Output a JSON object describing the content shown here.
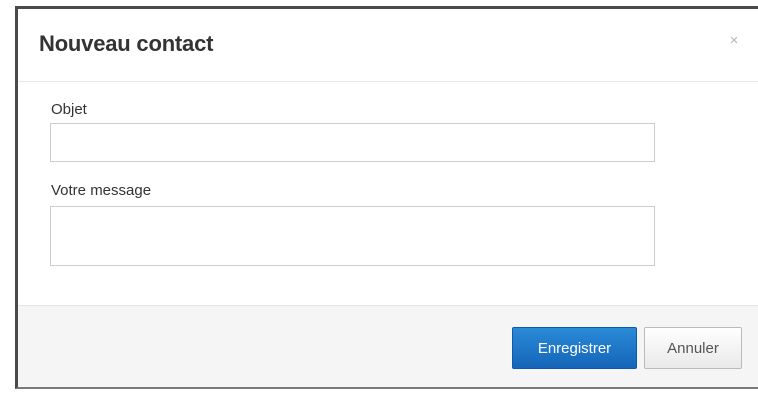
{
  "dialog": {
    "title": "Nouveau contact",
    "close_symbol": "×"
  },
  "form": {
    "subject_label": "Objet",
    "subject_value": "",
    "message_label": "Votre message",
    "message_value": ""
  },
  "footer": {
    "save_label": "Enregistrer",
    "cancel_label": "Annuler"
  },
  "colors": {
    "primary_button": "#1a74c7",
    "footer_background": "#f5f5f5",
    "title_text": "#333333"
  },
  "icons": {
    "close": "close-icon"
  }
}
